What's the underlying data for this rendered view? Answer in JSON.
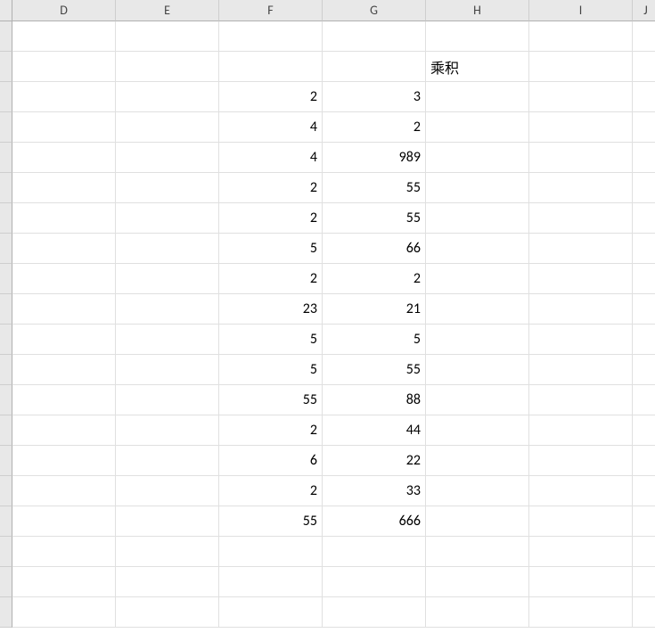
{
  "columns": [
    "D",
    "E",
    "F",
    "G",
    "H",
    "I",
    "J"
  ],
  "rows": [
    {
      "F": "",
      "G": "",
      "H": ""
    },
    {
      "F": "",
      "G": "",
      "H": "乘积",
      "H_type": "txt"
    },
    {
      "F": "2",
      "G": "3",
      "H": ""
    },
    {
      "F": "4",
      "G": "2",
      "H": ""
    },
    {
      "F": "4",
      "G": "989",
      "H": ""
    },
    {
      "F": "2",
      "G": "55",
      "H": ""
    },
    {
      "F": "2",
      "G": "55",
      "H": ""
    },
    {
      "F": "5",
      "G": "66",
      "H": ""
    },
    {
      "F": "2",
      "G": "2",
      "H": ""
    },
    {
      "F": "23",
      "G": "21",
      "H": ""
    },
    {
      "F": "5",
      "G": "5",
      "H": ""
    },
    {
      "F": "5",
      "G": "55",
      "H": ""
    },
    {
      "F": "55",
      "G": "88",
      "H": ""
    },
    {
      "F": "2",
      "G": "44",
      "H": ""
    },
    {
      "F": "6",
      "G": "22",
      "H": ""
    },
    {
      "F": "2",
      "G": "33",
      "H": ""
    },
    {
      "F": "55",
      "G": "666",
      "H": ""
    },
    {
      "F": "",
      "G": "",
      "H": ""
    },
    {
      "F": "",
      "G": "",
      "H": ""
    },
    {
      "F": "",
      "G": "",
      "H": ""
    }
  ]
}
